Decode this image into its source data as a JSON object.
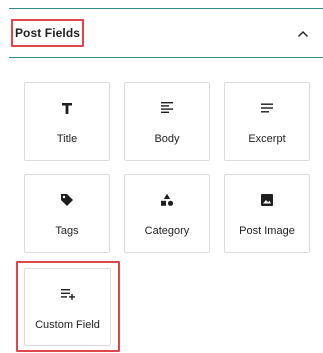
{
  "panel": {
    "title": "Post Fields",
    "collapse_icon": "chevron-up-icon"
  },
  "fields": [
    {
      "label": "Title",
      "icon": "heading-icon"
    },
    {
      "label": "Body",
      "icon": "align-left-icon"
    },
    {
      "label": "Excerpt",
      "icon": "text-lines-icon"
    },
    {
      "label": "Tags",
      "icon": "tag-icon"
    },
    {
      "label": "Category",
      "icon": "shapes-icon"
    },
    {
      "label": "Post Image",
      "icon": "image-icon"
    },
    {
      "label": "Custom Field",
      "icon": "list-add-icon"
    }
  ],
  "colors": {
    "accent_rule": "#2f8f84",
    "highlight": "#e0474c",
    "card_border": "#dcdcde"
  }
}
